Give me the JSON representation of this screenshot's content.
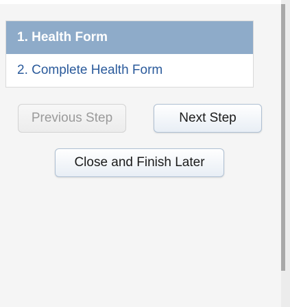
{
  "steps": [
    {
      "label": "1. Health Form",
      "active": true
    },
    {
      "label": "2. Complete Health Form",
      "active": false
    }
  ],
  "buttons": {
    "previous_label": "Previous Step",
    "next_label": "Next Step",
    "close_label": "Close and Finish Later"
  },
  "colors": {
    "active_step_bg": "#8eabc9",
    "active_step_text": "#ffffff",
    "inactive_step_text": "#2a5a9b",
    "panel_bg": "#f5f5f5"
  }
}
